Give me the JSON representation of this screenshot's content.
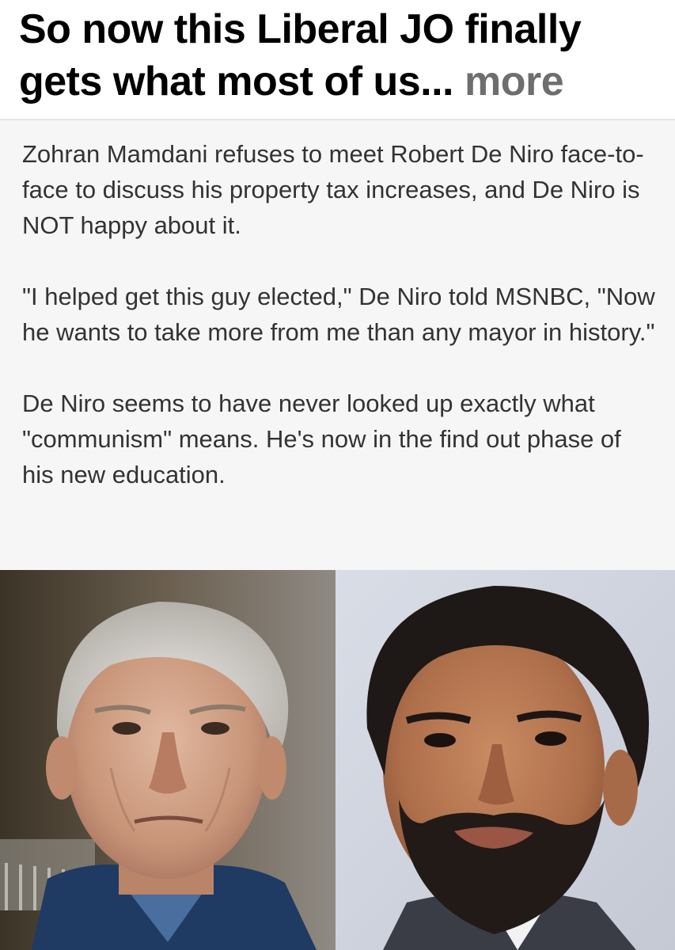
{
  "post": {
    "title_text": "So now this Liberal JO finally gets what most of us...",
    "more_label": "more"
  },
  "article": {
    "paragraphs": [
      "Zohran Mamdani refuses to meet Robert De Niro face-to-face to discuss his property tax increases, and De Niro is NOT happy about it.",
      "\"I helped get this guy elected,\" De Niro told MSNBC, \"Now he wants to take more from me than any mayor in history.\"",
      "De Niro seems to have never looked up exactly what \"communism\" means. He's now in the find out phase of his new education."
    ]
  },
  "photos": {
    "left_icon": "portrait-older-man-gray-hair",
    "right_icon": "portrait-bearded-man-dark-hair"
  },
  "colors": {
    "title": "#000000",
    "more": "#6e6e6e",
    "article_bg": "#f6f6f6",
    "article_text": "#333333"
  }
}
